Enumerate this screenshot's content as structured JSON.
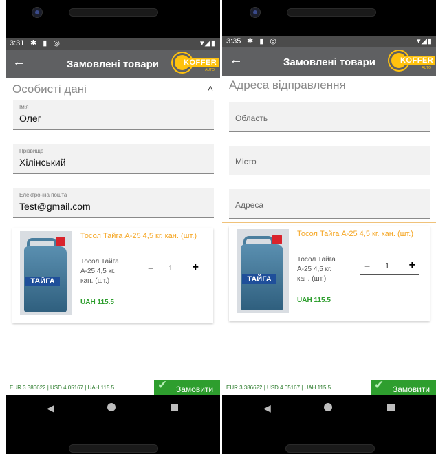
{
  "screen1": {
    "status": {
      "time": "3:31",
      "left_icons": "✱ ▮ ◎",
      "right_icons": "▾◢▮"
    },
    "appbar": {
      "back_icon": "arrow-left-icon",
      "title": "Замовлені товари",
      "logo_text": "KOFFER",
      "logo_sub": "AUTO"
    },
    "section": {
      "title": "Особисті дані",
      "chevron": "˄"
    },
    "fields": [
      {
        "label": "Ім'я",
        "value": "Олег"
      },
      {
        "label": "Прізвище",
        "value": "Хілінський"
      },
      {
        "label": "Електронна пошта",
        "value": "Test@gmail.com"
      }
    ],
    "product": {
      "name": "Тосол Тайга А-25 4,5 кг. кан. (шт.)",
      "description": "Тосол Тайга А-25 4,5 кг. кан. (шт.)",
      "brand_label": "ТАЙГА",
      "qty": "1",
      "minus": "−",
      "plus": "+",
      "price": "UAH 115.5"
    },
    "bottom": {
      "rates": "EUR 3.386622 | USD 4.05167 | UAH 115.5",
      "order_label": "Замовити",
      "check_icon": "✔"
    }
  },
  "screen2": {
    "status": {
      "time": "3:35",
      "left_icons": "✱ ▮ ◎",
      "right_icons": "▾◢▮"
    },
    "appbar": {
      "back_icon": "arrow-left-icon",
      "title": "Замовлені товари",
      "logo_text": "KOFFER",
      "logo_sub": "AUTO"
    },
    "section": {
      "title": "Адреса відправлення"
    },
    "fields": [
      {
        "placeholder": "Область"
      },
      {
        "placeholder": "Місто"
      },
      {
        "placeholder": "Адреса"
      }
    ],
    "product": {
      "name": "Тосол Тайга А-25 4,5 кг. кан. (шт.)",
      "description": "Тосол Тайга А-25 4,5 кг. кан. (шт.)",
      "brand_label": "ТАЙГА",
      "qty": "1",
      "minus": "−",
      "plus": "+",
      "price": "UAH 115.5"
    },
    "bottom": {
      "rates": "EUR 3.386622 | USD 4.05167 | UAH 115.5",
      "order_label": "Замовити",
      "check_icon": "✔"
    }
  },
  "nav": {
    "back": "◀"
  }
}
